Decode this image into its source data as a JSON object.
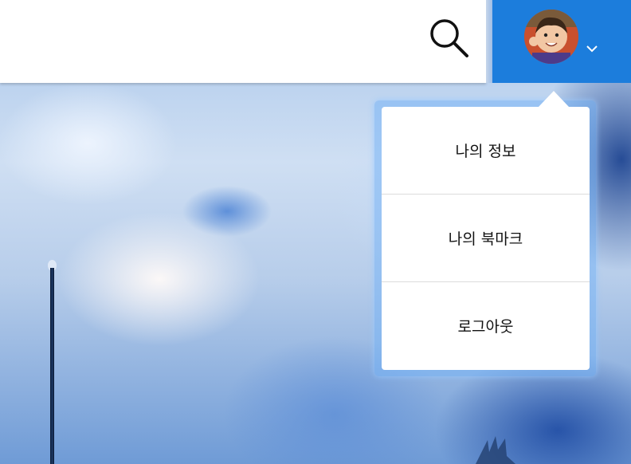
{
  "header": {
    "search_icon": "search-icon",
    "account_chevron_icon": "chevron-down-icon"
  },
  "account_menu": {
    "items": [
      {
        "label": "나의 정보"
      },
      {
        "label": "나의 북마크"
      },
      {
        "label": "로그아웃"
      }
    ]
  },
  "colors": {
    "header_bg": "#ffffff",
    "account_bg": "#1c7ddc",
    "menu_bg": "#ffffff"
  }
}
